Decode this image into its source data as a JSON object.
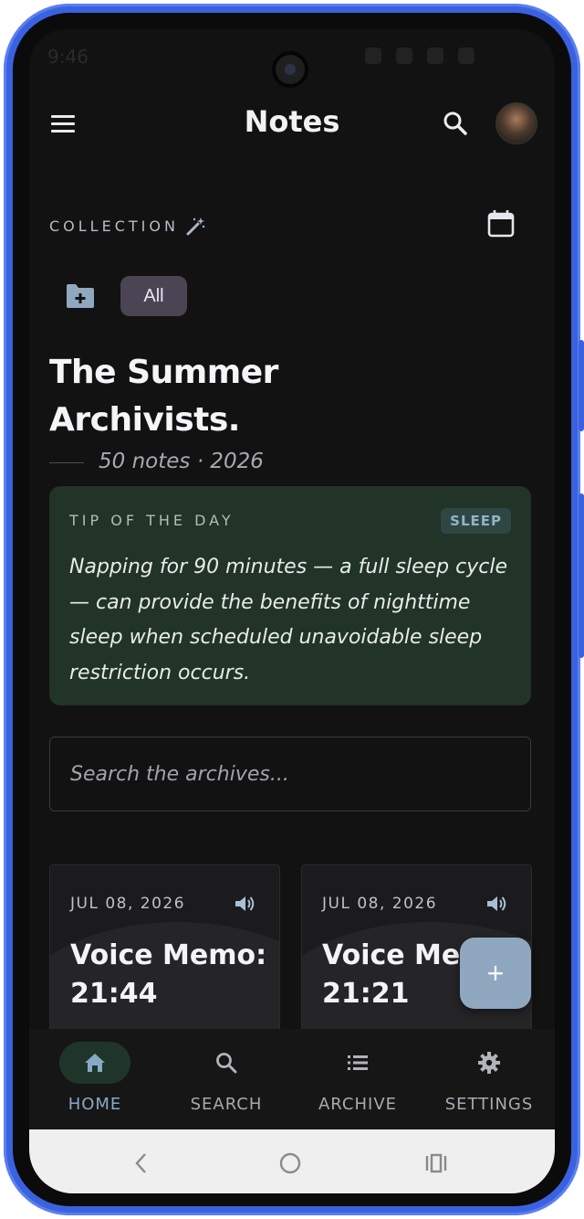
{
  "status_bar": {
    "time": "9:46"
  },
  "app_bar": {
    "title": "Notes"
  },
  "collection": {
    "label": "COLLECTION",
    "filter_all": "All",
    "title": "The Summer Archivists.",
    "meta": "50 notes · 2026"
  },
  "tip": {
    "label": "TIP OF THE DAY",
    "tag": "SLEEP",
    "text": "Napping for 90 minutes — a full sleep cycle — can provide the benefits of nighttime sleep when scheduled unavoidable sleep restriction occurs."
  },
  "search": {
    "placeholder": "Search the archives..."
  },
  "notes": [
    {
      "date": "JUL 08, 2026",
      "title_line1": "Voice Memo:",
      "title_line2": "21:44",
      "snippet": "",
      "icon": "speaker-icon"
    },
    {
      "date": "JUL 08, 2026",
      "title_line1": "Voice Mem",
      "title_line2": "21:21",
      "snippet": "",
      "icon": "speaker-icon"
    }
  ],
  "fab": {
    "label": "+"
  },
  "bottom_nav": [
    {
      "label": "HOME",
      "icon": "home-icon",
      "active": true
    },
    {
      "label": "SEARCH",
      "icon": "search-icon",
      "active": false
    },
    {
      "label": "ARCHIVE",
      "icon": "list-icon",
      "active": false
    },
    {
      "label": "SETTINGS",
      "icon": "gear-icon",
      "active": false
    }
  ],
  "colors": {
    "background": "#121212",
    "accent": "#88a9c6",
    "tip_card": "#223327",
    "chip": "#4a4454",
    "fab": "#8fa8bf",
    "frame": "#3a62e0"
  }
}
